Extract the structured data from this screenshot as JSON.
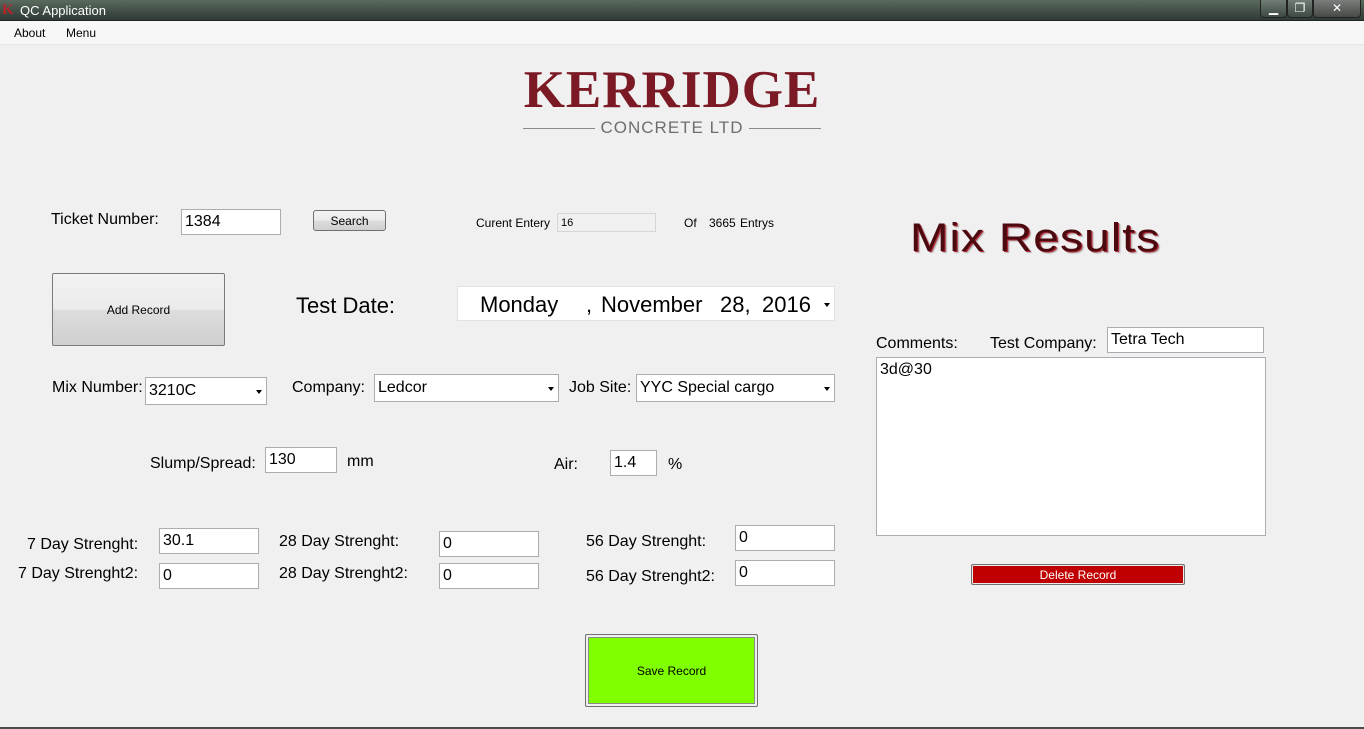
{
  "window": {
    "title": "QC Application",
    "icon_letter": "K",
    "minimize_label": "▁",
    "restore_label": "❐",
    "close_label": "✕"
  },
  "menu": {
    "about": "About",
    "menu": "Menu"
  },
  "logo": {
    "name": "KERRIDGE",
    "sub": "CONCRETE LTD"
  },
  "heading": "Mix Results",
  "ticket": {
    "label": "Ticket Number:",
    "value": "1384",
    "search_label": "Search"
  },
  "entry": {
    "label": "Curent Entery",
    "current": "16",
    "of_label": "Of",
    "total": "3665",
    "entries_label": "Entrys"
  },
  "add_record_label": "Add Record",
  "test_date": {
    "label": "Test Date:",
    "weekday": "Monday",
    "sep": ",",
    "month": "November",
    "day": "28,",
    "year": "2016"
  },
  "mix": {
    "label": "Mix Number:",
    "value": "3210C"
  },
  "company": {
    "label": "Company:",
    "value": "Ledcor"
  },
  "job_site": {
    "label": "Job Site:",
    "value": "YYC Special cargo"
  },
  "slump": {
    "label": "Slump/Spread:",
    "value": "130",
    "unit": "mm"
  },
  "air": {
    "label": "Air:",
    "value": "1.4",
    "unit": "%"
  },
  "strength": {
    "d7_label": "7 Day Strenght:",
    "d7_value": "30.1",
    "d7b_label": "7 Day Strenght2:",
    "d7b_value": "0",
    "d28_label": "28 Day Strenght:",
    "d28_value": "0",
    "d28b_label": "28 Day Strenght2:",
    "d28b_value": "0",
    "d56_label": "56 Day Strenght:",
    "d56_value": "0",
    "d56b_label": "56 Day Strenght2:",
    "d56b_value": "0"
  },
  "comments": {
    "label": "Comments:",
    "value": "3d@30"
  },
  "test_company": {
    "label": "Test Company:",
    "value": "Tetra Tech"
  },
  "delete_label": "Delete Record",
  "save_label": "Save Record",
  "colors": {
    "save": "#80ff00",
    "delete": "#c00000",
    "brand": "#7b1a24",
    "heading": "#4a0a10"
  }
}
